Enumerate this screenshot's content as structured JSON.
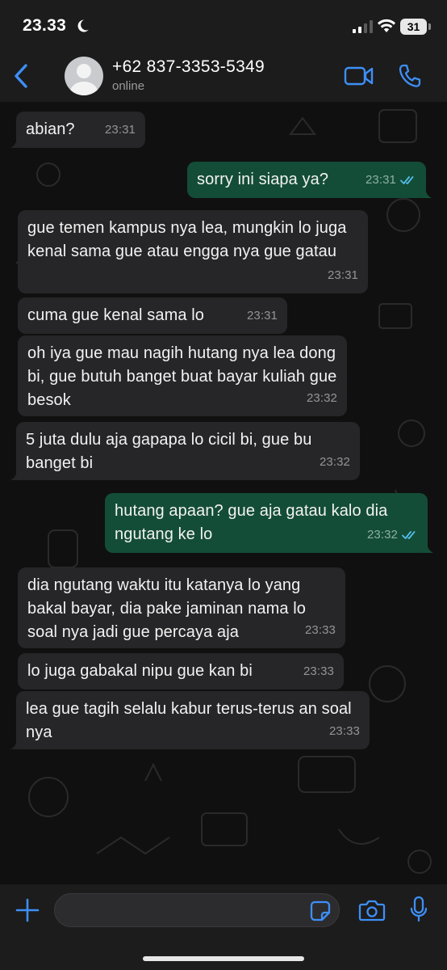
{
  "status_bar": {
    "time": "23.33",
    "battery": "31",
    "icons": [
      "moon-icon",
      "signal-icon",
      "wifi-icon",
      "battery-icon"
    ]
  },
  "header": {
    "contact_name": "+62 837-3353-5349",
    "contact_status": "online",
    "icons": [
      "back-chevron-icon",
      "avatar-icon",
      "video-call-icon",
      "phone-icon"
    ]
  },
  "messages": [
    {
      "dir": "in",
      "text": "abian?",
      "time": "23:31"
    },
    {
      "dir": "out",
      "text": "sorry ini siapa ya?",
      "time": "23:31",
      "read": true
    },
    {
      "dir": "in",
      "text": "gue temen kampus nya lea, mungkin lo juga kenal sama gue atau engga nya gue gatau",
      "time": "23:31"
    },
    {
      "dir": "in",
      "text": "cuma gue kenal sama lo",
      "time": "23:31"
    },
    {
      "dir": "in",
      "text": "oh iya gue mau nagih hutang nya lea dong bi, gue butuh banget buat bayar kuliah gue besok",
      "time": "23:32"
    },
    {
      "dir": "in",
      "text": "5 juta dulu aja gapapa lo cicil bi, gue bu banget bi",
      "time": "23:32"
    },
    {
      "dir": "out",
      "text": "hutang apaan? gue aja gatau kalo dia ngutang ke lo",
      "time": "23:32",
      "read": true
    },
    {
      "dir": "in",
      "text": "dia ngutang waktu itu katanya lo yang bakal bayar, dia pake jaminan nama lo soal nya jadi gue percaya aja",
      "time": "23:33"
    },
    {
      "dir": "in",
      "text": "lo juga gabakal nipu gue kan bi",
      "time": "23:33"
    },
    {
      "dir": "in",
      "text": "lea gue tagih selalu kabur terus-terus an soal nya",
      "time": "23:33"
    }
  ],
  "input": {
    "value": "",
    "icons": [
      "plus-icon",
      "sticker-icon",
      "camera-icon",
      "microphone-icon"
    ]
  },
  "colors": {
    "incoming_bubble": "#262628",
    "outgoing_bubble": "#144d37",
    "accent": "#3e8ff7",
    "bar_background": "#1c1c1c",
    "read_receipt": "#53bdeb"
  }
}
